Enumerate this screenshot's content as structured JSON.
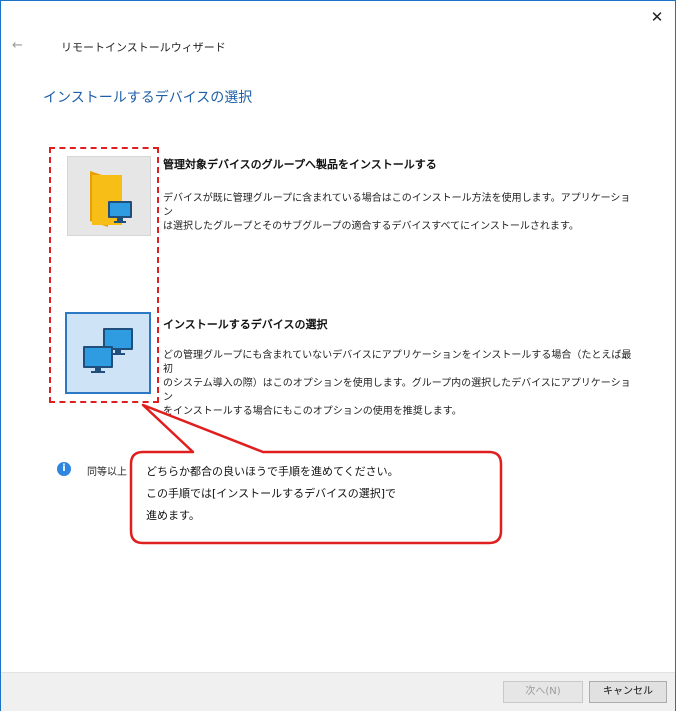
{
  "header": {
    "back_icon": "←",
    "wizard_title": "リモートインストールウィザード",
    "close_icon": "✕"
  },
  "page_title": "インストールするデバイスの選択",
  "options": [
    {
      "heading": "管理対象デバイスのグループへ製品をインストールする",
      "desc_lines": [
        "デバイスが既に管理グループに含まれている場合はこのインストール方法を使用します。アプリケーション",
        "は選択したグループとそのサブグループの適合するデバイスすべてにインストールされます。"
      ],
      "icon": "folder-computer-icon"
    },
    {
      "heading": "インストールするデバイスの選択",
      "desc_lines": [
        "どの管理グループにも含まれていないデバイスにアプリケーションをインストールする場合（たとえば最初",
        "のシステム導入の際）はこのオプションを使用します。グループ内の選択したデバイスにアプリケーション",
        "をインストールする場合にもこのオプションの使用を推奨します。"
      ],
      "icon": "multiple-computers-icon"
    }
  ],
  "info": {
    "icon": "i",
    "text": "同等以上"
  },
  "callout": {
    "lines": [
      "どちらか都合の良いほうで手順を進めてください。",
      "この手順では[インストールするデバイスの選択]で",
      "進めます。"
    ]
  },
  "footer": {
    "next_label": "次へ(N)",
    "cancel_label": "キャンセル"
  },
  "colors": {
    "accent": "#1f5fa8",
    "annotation_red": "#e01e1e",
    "selected_tile": "#cfe3f6"
  }
}
